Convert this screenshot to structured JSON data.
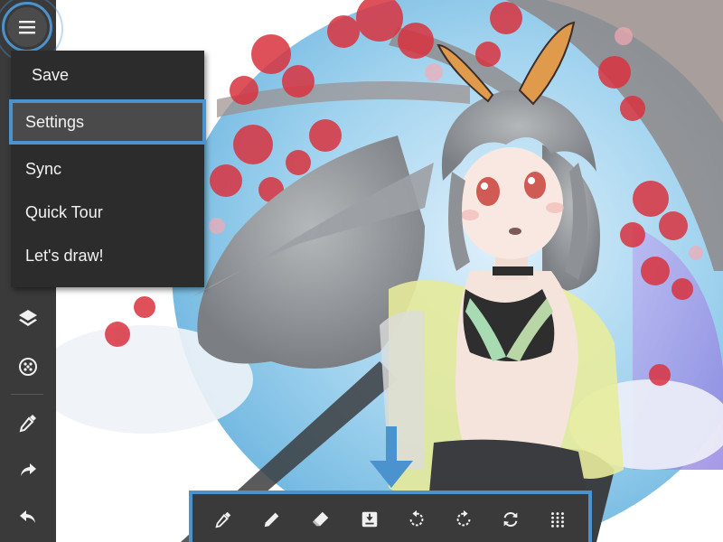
{
  "menu": {
    "items": [
      {
        "label": "Save"
      },
      {
        "label": "Settings"
      },
      {
        "label": "Sync"
      },
      {
        "label": "Quick Tour"
      },
      {
        "label": "Let's draw!"
      }
    ],
    "selected_index": 1
  },
  "left_toolbar": {
    "icons": [
      "menu-icon",
      "layers-icon",
      "brush-palette-icon",
      "eyedropper-icon",
      "redo-icon",
      "undo-icon"
    ]
  },
  "bottom_toolbar": {
    "icons": [
      "eyedropper-icon",
      "pencil-icon",
      "eraser-icon",
      "import-icon",
      "rotate-ccw-icon",
      "rotate-cw-icon",
      "flip-icon",
      "grid-icon"
    ]
  },
  "colors": {
    "highlight": "#4a93cf",
    "toolbar_bg": "#3a3a3a",
    "menu_bg": "#2c2c2c",
    "icon": "#f0f0f0"
  }
}
